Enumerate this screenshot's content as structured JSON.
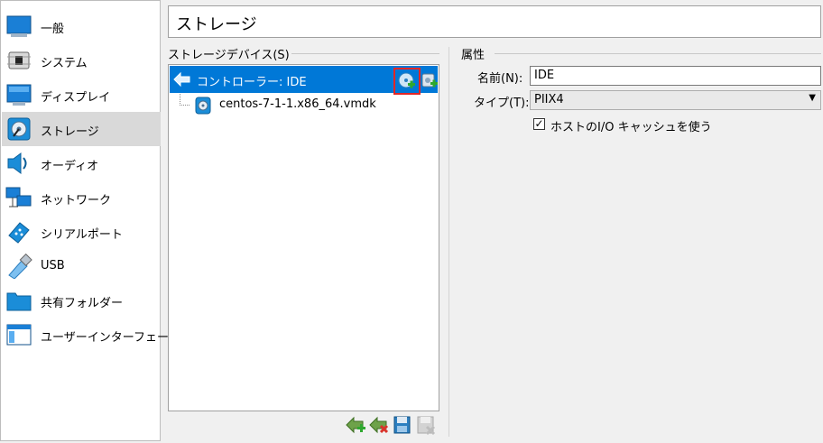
{
  "sidebar": {
    "items": [
      {
        "label": "一般",
        "icon": "general-icon"
      },
      {
        "label": "システム",
        "icon": "system-icon"
      },
      {
        "label": "ディスプレイ",
        "icon": "display-icon"
      },
      {
        "label": "ストレージ",
        "icon": "storage-icon",
        "selected": true
      },
      {
        "label": "オーディオ",
        "icon": "audio-icon"
      },
      {
        "label": "ネットワーク",
        "icon": "network-icon"
      },
      {
        "label": "シリアルポート",
        "icon": "serial-port-icon"
      },
      {
        "label": "USB",
        "icon": "usb-icon"
      },
      {
        "label": "共有フォルダー",
        "icon": "shared-folder-icon"
      },
      {
        "label": "ユーザーインターフェース",
        "icon": "user-interface-icon"
      }
    ]
  },
  "page_title": "ストレージ",
  "storage_devices": {
    "label": "ストレージデバイス(S)",
    "controller": {
      "label": "コントローラー: IDE"
    },
    "disks": [
      {
        "label": "centos-7-1-1.x86_64.vmdk"
      }
    ]
  },
  "attributes": {
    "label": "属性",
    "name_label": "名前(N):",
    "name_value": "IDE",
    "type_label": "タイプ(T):",
    "type_value": "PIIX4",
    "cache_label": "ホストのI/O キャッシュを使う",
    "cache_checked": true
  },
  "colors": {
    "selection": "#0078d7",
    "highlight_border": "#e32626",
    "sidebar_selected": "#d9d9d9"
  }
}
